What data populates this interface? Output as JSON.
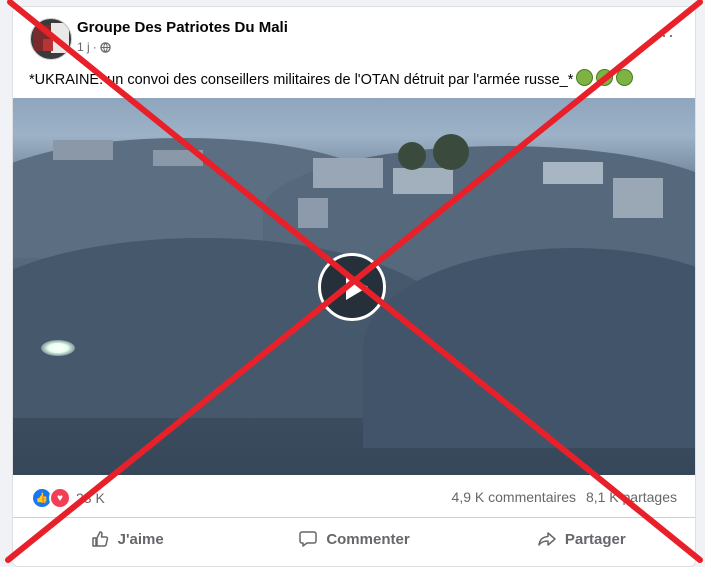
{
  "post": {
    "page_name": "Groupe Des Patriotes Du Mali",
    "time": "1 j",
    "separator": "·",
    "text": "*UKRAINE: un convoi des conseillers militaires de l'OTAN détruit par l'armée russe_*",
    "more": "···"
  },
  "stats": {
    "reactions_count": "23 K",
    "comments": "4,9 K commentaires",
    "shares": "8,1 K partages"
  },
  "actions": {
    "like": "J'aime",
    "comment": "Commenter",
    "share": "Partager"
  },
  "colors": {
    "overlay_cross": "#e8202a",
    "like_blue": "#1877f2",
    "love_red": "#f33e58"
  }
}
